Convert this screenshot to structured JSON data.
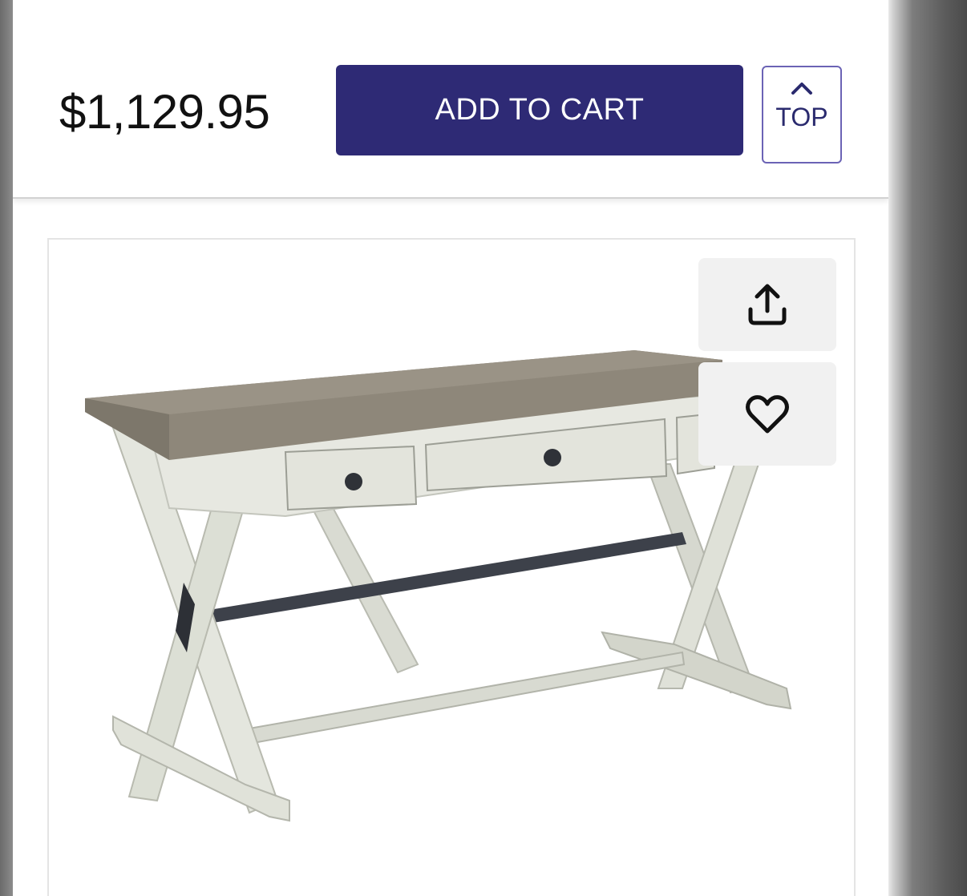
{
  "buy_bar": {
    "price": "$1,129.95",
    "add_to_cart_label": "ADD TO CART",
    "top_label": "TOP"
  },
  "icons": {
    "back_to_top": "chevron-up-icon",
    "share": "share-icon",
    "wishlist": "heart-icon"
  },
  "product": {
    "image_subject": "trestle desk with drawers"
  },
  "colors": {
    "primary": "#2e2a75",
    "price_text": "#111111",
    "top_border": "#6b63b5"
  }
}
